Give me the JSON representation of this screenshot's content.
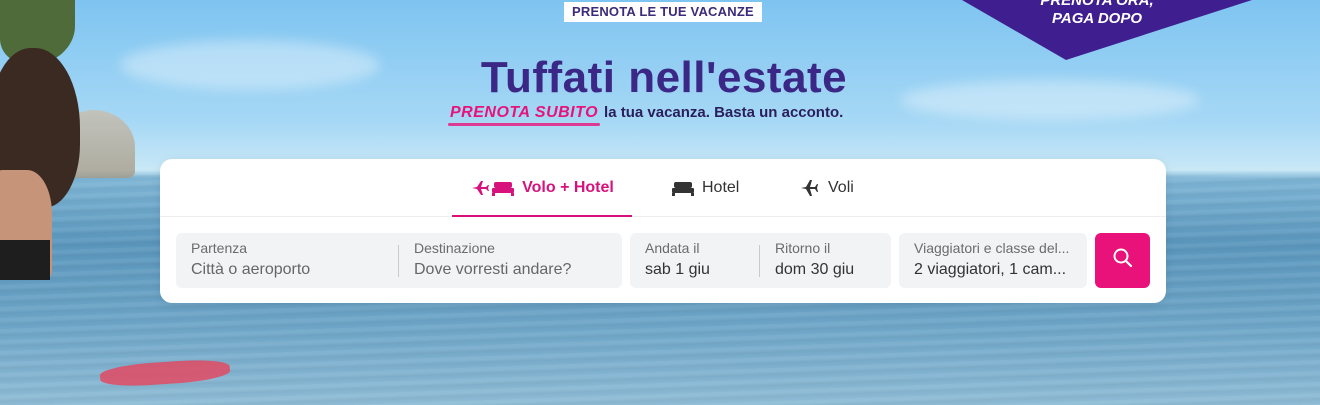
{
  "banner": {
    "top_badge": "PRENOTA LE TUE VACANZE"
  },
  "promo": {
    "line1": "PRENOTA ORA,",
    "line2": "PAGA DOPO"
  },
  "hero": {
    "title": "Tuffati nell'estate",
    "highlight": "PRENOTA SUBITO",
    "subtitle": "la tua vacanza. Basta un acconto."
  },
  "tabs": [
    {
      "label": "Volo + Hotel",
      "icon": "plane-bed-icon",
      "active": true
    },
    {
      "label": "Hotel",
      "icon": "bed-icon",
      "active": false
    },
    {
      "label": "Voli",
      "icon": "plane-icon",
      "active": false
    }
  ],
  "search": {
    "departure": {
      "label": "Partenza",
      "placeholder": "Città o aeroporto"
    },
    "destination": {
      "label": "Destinazione",
      "placeholder": "Dove vorresti andare?"
    },
    "outbound": {
      "label": "Andata il",
      "value": "sab 1 giu"
    },
    "return": {
      "label": "Ritorno il",
      "value": "dom 30 giu"
    },
    "travellers": {
      "label": "Viaggiatori e classe del...",
      "value": "2 viaggiatori, 1 cam..."
    },
    "button_icon": "search-icon"
  },
  "colors": {
    "brand": "#e8127a",
    "title": "#3b2785"
  }
}
